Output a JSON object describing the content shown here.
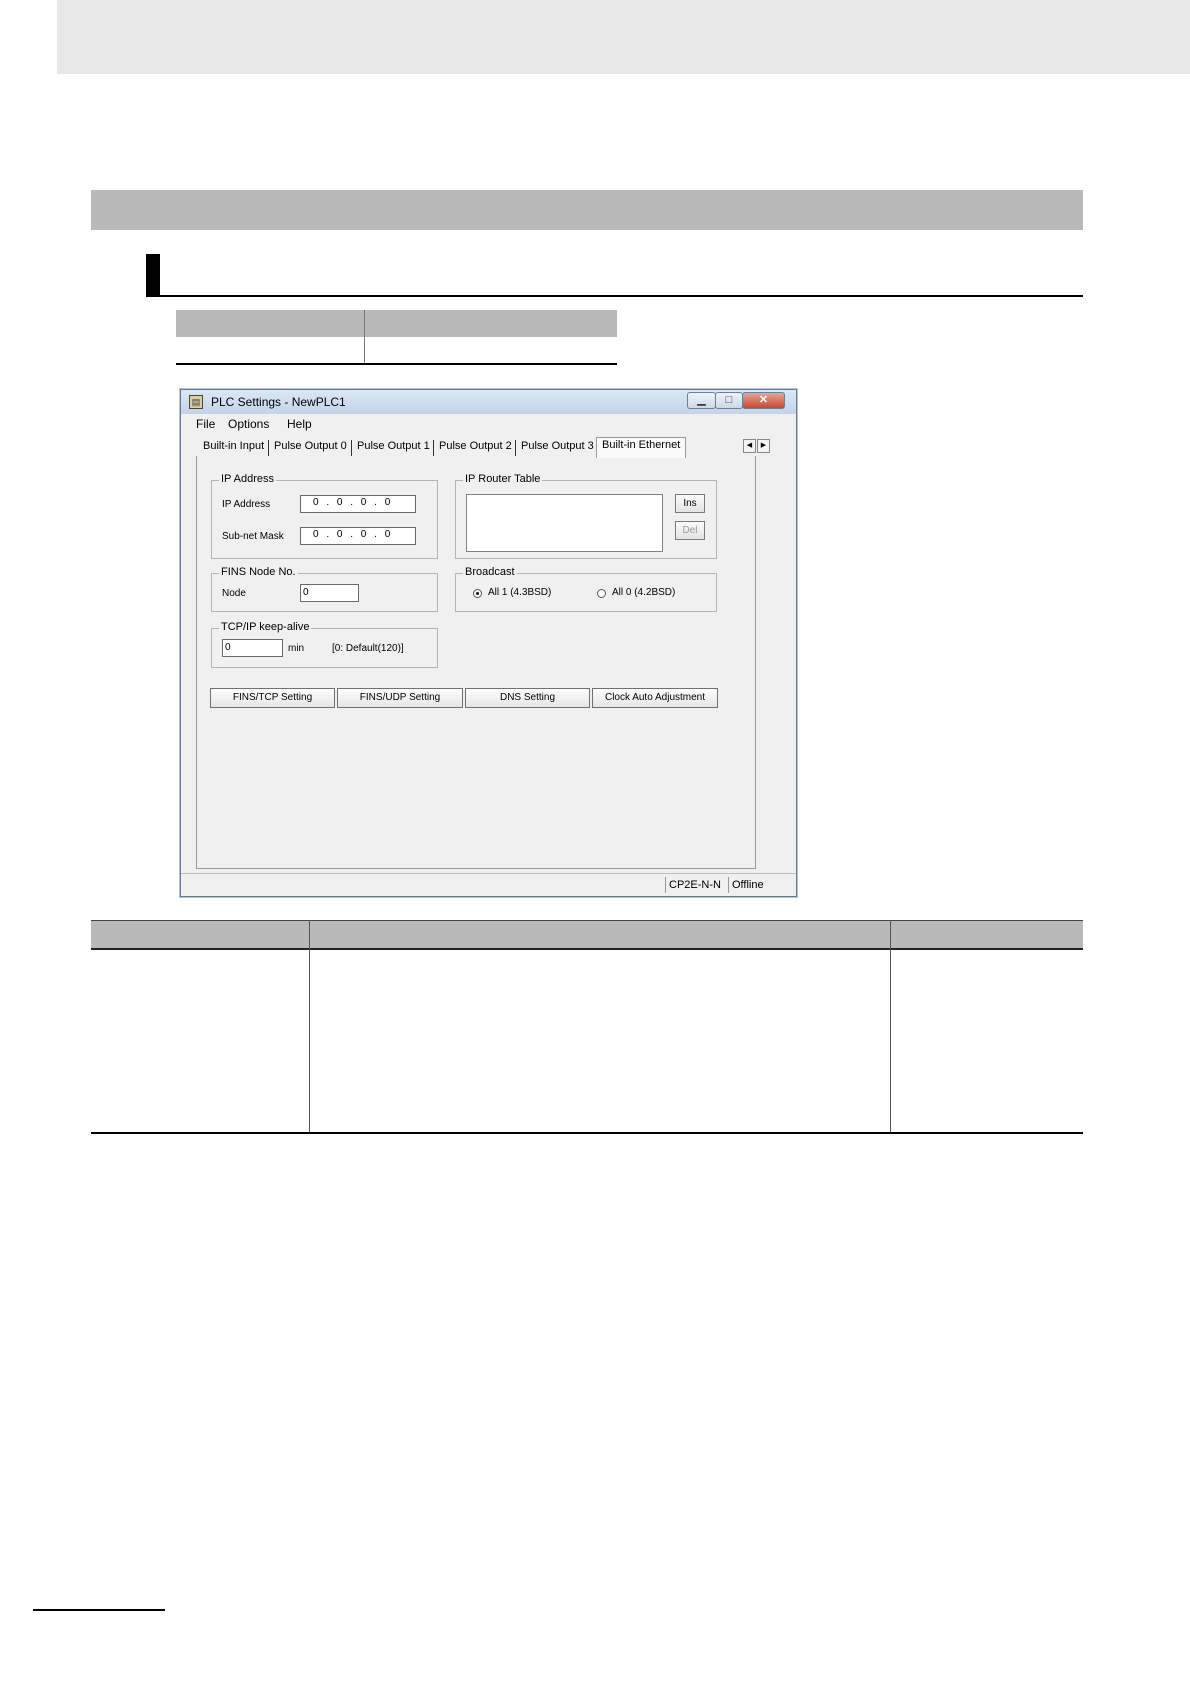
{
  "window": {
    "title": "PLC Settings - NewPLC1",
    "menu": [
      "File",
      "Options",
      "Help"
    ],
    "tabs": [
      "Built-in Input",
      "Pulse Output 0",
      "Pulse Output 1",
      "Pulse Output 2",
      "Pulse Output 3",
      "Built-in Ethernet"
    ],
    "active_tab": "Built-in Ethernet"
  },
  "ip_address": {
    "group_title": "IP Address",
    "ip_label": "IP Address",
    "ip_value": "0 . 0 . 0 . 0",
    "mask_label": "Sub-net Mask",
    "mask_value": "0 . 0 . 0 . 0"
  },
  "router_table": {
    "group_title": "IP Router Table",
    "ins_label": "Ins",
    "del_label": "Del"
  },
  "fins_node": {
    "group_title": "FINS Node No.",
    "node_label": "Node",
    "node_value": "0"
  },
  "broadcast": {
    "group_title": "Broadcast",
    "option1": "All 1 (4.3BSD)",
    "option2": "All 0 (4.2BSD)",
    "selected": "All 1 (4.3BSD)"
  },
  "keep_alive": {
    "group_title": "TCP/IP keep-alive",
    "value": "0",
    "unit": "min",
    "note": "[0: Default(120)]"
  },
  "buttons": {
    "fins_tcp": "FINS/TCP Setting",
    "fins_udp": "FINS/UDP Setting",
    "dns": "DNS Setting",
    "clock": "Clock Auto Adjustment"
  },
  "status": {
    "model": "CP2E-N-N",
    "mode": "Offline"
  },
  "icons": {
    "minimize": "minimize-icon",
    "maximize": "maximize-icon",
    "close": "close-icon",
    "scroll_left": "arrow-left-icon",
    "scroll_right": "arrow-right-icon"
  }
}
